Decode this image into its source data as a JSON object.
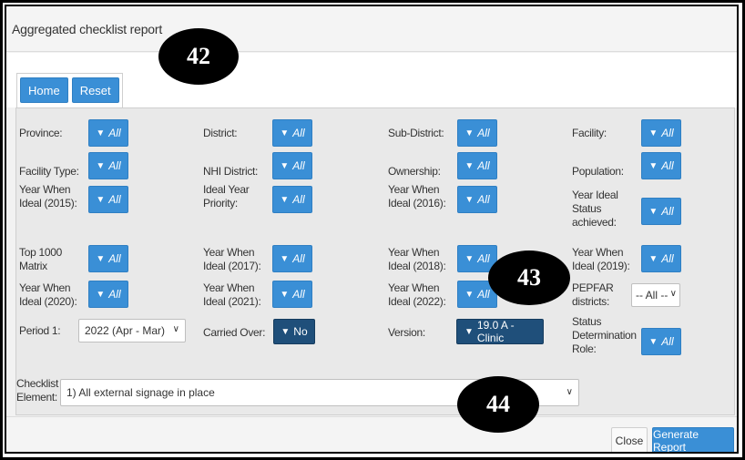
{
  "modal": {
    "title": "Aggregated checklist report"
  },
  "toolbar": {
    "home_label": "Home",
    "reset_label": "Reset"
  },
  "filters": {
    "all_label": "All",
    "province": "Province:",
    "district": "District:",
    "sub_district": "Sub-District:",
    "facility": "Facility:",
    "facility_type": "Facility Type:",
    "nhi_district": "NHI District:",
    "ownership": "Ownership:",
    "population": "Population:",
    "ywi_2015_l1": "Year When",
    "ywi_2015_l2": "Ideal (2015):",
    "iyp_l1": "Ideal Year",
    "iyp_l2": "Priority:",
    "ywi_2016_l1": "Year When",
    "ywi_2016_l2": "Ideal (2016):",
    "yisa_l1": "Year Ideal",
    "yisa_l2": "Status",
    "yisa_l3": "achieved:",
    "top1000_l1": "Top 1000",
    "top1000_l2": "Matrix",
    "ywi_2017_l1": "Year When",
    "ywi_2017_l2": "Ideal (2017):",
    "ywi_2018_l1": "Year When",
    "ywi_2018_l2": "Ideal (2018):",
    "ywi_2019_l1": "Year When",
    "ywi_2019_l2": "Ideal (2019):",
    "ywi_2020_l1": "Year When",
    "ywi_2020_l2": "Ideal (2020):",
    "ywi_2021_l1": "Year When",
    "ywi_2021_l2": "Ideal (2021):",
    "ywi_2022_l1": "Year When",
    "ywi_2022_l2": "Ideal (2022):",
    "pepfar_l1": "PEPFAR",
    "pepfar_l2": "districts:",
    "pepfar_value": "-- All --",
    "period1": "Period 1:",
    "period1_value": "2022 (Apr - Mar)",
    "carried_over": "Carried Over:",
    "carried_over_value": "No",
    "version": "Version:",
    "version_value": "19.0 A - Clinic",
    "sdr_l1": "Status",
    "sdr_l2": "Determination",
    "sdr_l3": "Role:",
    "checklist_l1": "Checklist",
    "checklist_l2": "Element:",
    "checklist_value": "1) All external signage in place"
  },
  "footer": {
    "close_label": "Close",
    "generate_label": "Generate Report"
  },
  "callouts": [
    "42",
    "43",
    "44"
  ],
  "colors": {
    "primary": "#3a8fd6",
    "dark_primary": "#1f4f7a"
  }
}
